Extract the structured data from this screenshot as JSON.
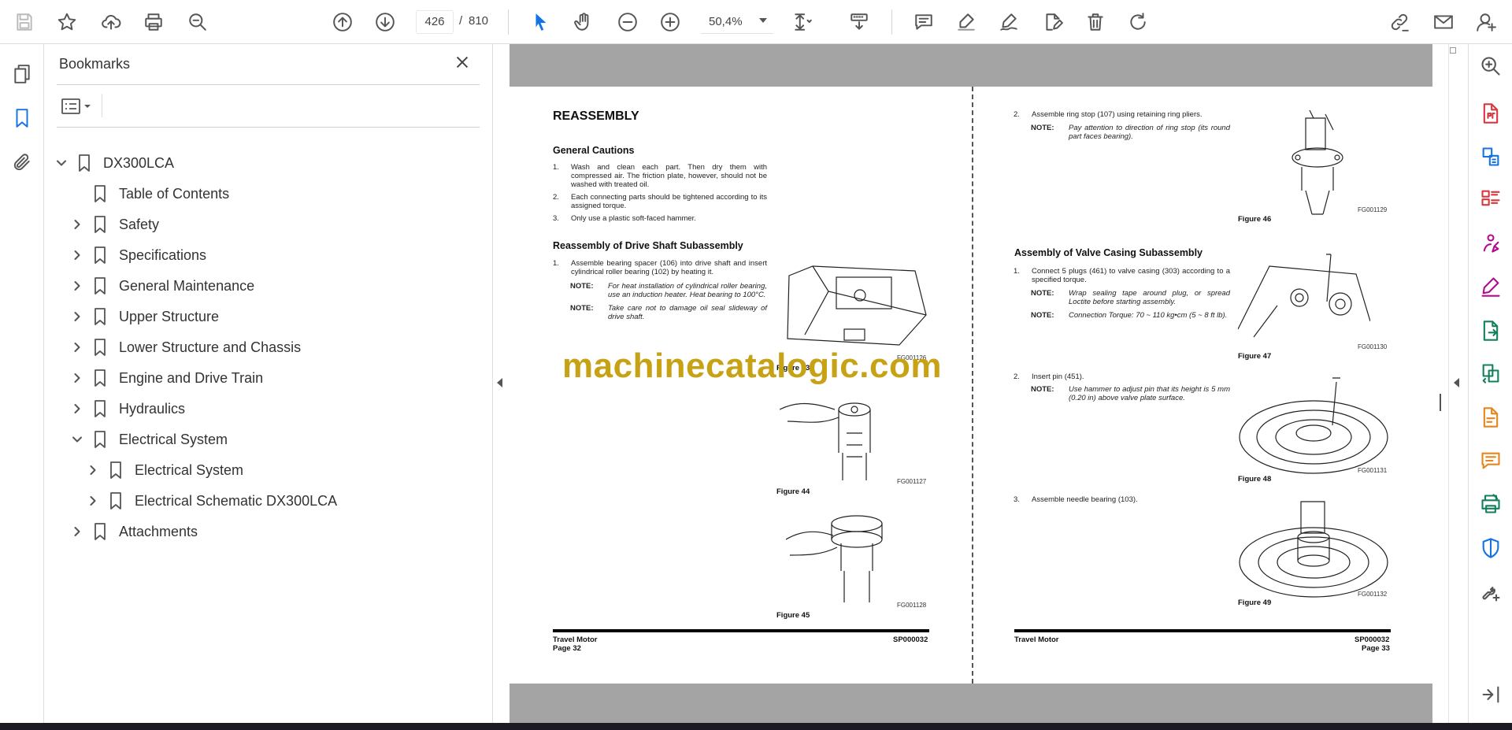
{
  "toolbar": {
    "page_current": "426",
    "page_separator": "/",
    "page_total": "810",
    "zoom": "50,4%",
    "icons": [
      "save-icon",
      "star-icon",
      "upload-cloud-icon",
      "print-icon",
      "find-zoom-icon",
      "page-up-icon",
      "page-down-icon",
      "select-cursor-icon",
      "hand-icon",
      "zoom-out-icon",
      "zoom-in-icon",
      "fit-page-icon",
      "scroll-mode-icon",
      "comment-icon",
      "highlight-icon",
      "draw-icon",
      "edit-pdf-icon",
      "delete-icon",
      "rotate-icon",
      "share-link-icon",
      "email-icon",
      "account-icon"
    ]
  },
  "left_rail": {
    "icons": [
      "pages-icon",
      "bookmark-icon",
      "attachment-icon"
    ]
  },
  "bookmarks": {
    "title": "Bookmarks",
    "items": [
      {
        "label": "DX300LCA",
        "expander": "expanded"
      },
      {
        "label": "Table of Contents",
        "expander": "none"
      },
      {
        "label": "Safety",
        "expander": "collapsed"
      },
      {
        "label": "Specifications",
        "expander": "collapsed"
      },
      {
        "label": "General Maintenance",
        "expander": "collapsed"
      },
      {
        "label": "Upper Structure",
        "expander": "collapsed"
      },
      {
        "label": "Lower Structure and Chassis",
        "expander": "collapsed"
      },
      {
        "label": "Engine and Drive Train",
        "expander": "collapsed"
      },
      {
        "label": "Hydraulics",
        "expander": "collapsed"
      },
      {
        "label": "Electrical System",
        "expander": "expanded"
      },
      {
        "label": "Electrical System",
        "expander": "collapsed"
      },
      {
        "label": "Electrical Schematic DX300LCA",
        "expander": "collapsed"
      },
      {
        "label": "Attachments",
        "expander": "collapsed"
      }
    ]
  },
  "document": {
    "left_page": {
      "heading": "REASSEMBLY",
      "general_cautions_title": "General Cautions",
      "gc1_num": "1.",
      "gc1": "Wash and clean each part. Then dry them with compressed air. The friction plate, however, should not be washed with treated oil.",
      "gc2_num": "2.",
      "gc2": "Each connecting parts should be tightened according to its assigned torque.",
      "gc3_num": "3.",
      "gc3": "Only use a plastic soft-faced hammer.",
      "drive_shaft_title": "Reassembly of Drive Shaft Subassembly",
      "ds1_num": "1.",
      "ds1": "Assemble bearing spacer (106) into drive shaft and insert cylindrical roller bearing (102) by heating it.",
      "note_label": "NOTE:",
      "ds_note1": "For heat installation of cylindrical roller bearing, use an induction heater. Heat bearing to 100°C.",
      "ds_note2": "Take care not to damage oil seal slideway of drive shaft.",
      "fig43_code": "FG001126",
      "fig43_cap": "Figure 43",
      "fig44_code": "FG001127",
      "fig44_cap": "Figure 44",
      "fig45_code": "FG001128",
      "fig45_cap": "Figure 45",
      "footer_left": "Travel Motor",
      "footer_page": "Page 32",
      "footer_right": "SP000032"
    },
    "right_page": {
      "rs2_num": "2.",
      "rs2": "Assemble ring stop (107) using retaining ring pliers.",
      "note_label": "NOTE:",
      "rs_note": "Pay attention to direction of ring stop (its round part faces bearing).",
      "fig46_code": "FG001129",
      "fig46_cap": "Figure 46",
      "valve_title": "Assembly of Valve Casing Subassembly",
      "vc1_num": "1.",
      "vc1": "Connect 5 plugs (461) to valve casing (303) according to a specified torque.",
      "vc_note1": "Wrap sealing tape around plug, or spread Loctite before starting assembly.",
      "vc_note2": "Connection Torque: 70 ~ 110 kg•cm (5 ~ 8 ft lb).",
      "fig47_code": "FG001130",
      "fig47_cap": "Figure 47",
      "vc2_num": "2.",
      "vc2": "Insert pin (451).",
      "vc_note3": "Use hammer to adjust pin that its height is 5 mm (0.20 in) above valve plate surface.",
      "fig48_code": "FG001131",
      "fig48_cap": "Figure 48",
      "vc3_num": "3.",
      "vc3": "Assemble needle bearing (103).",
      "fig49_code": "FG001132",
      "fig49_cap": "Figure 49",
      "footer_left": "Travel Motor",
      "footer_page": "Page 33",
      "footer_right": "SP000032"
    },
    "watermark": "machinecatalogic.com"
  },
  "right_rail": {
    "icons": [
      "zoom-search-icon",
      "export-pdf-icon",
      "create-pdf-icon",
      "organize-pages-icon",
      "request-signature-icon",
      "fill-sign-icon",
      "send-review-icon",
      "compare-icon",
      "scan-ocr-icon",
      "comment-tool-icon",
      "print-production-icon",
      "protect-icon",
      "more-tools-icon",
      "collapse-rail-icon"
    ],
    "colors": [
      "#555555",
      "#d7373f",
      "#1473e6",
      "#d7373f",
      "#b30b8e",
      "#b30b8e",
      "#12805c",
      "#12805c",
      "#e68619",
      "#e68619",
      "#12805c",
      "#1473e6",
      "#555555",
      "#555555"
    ]
  }
}
